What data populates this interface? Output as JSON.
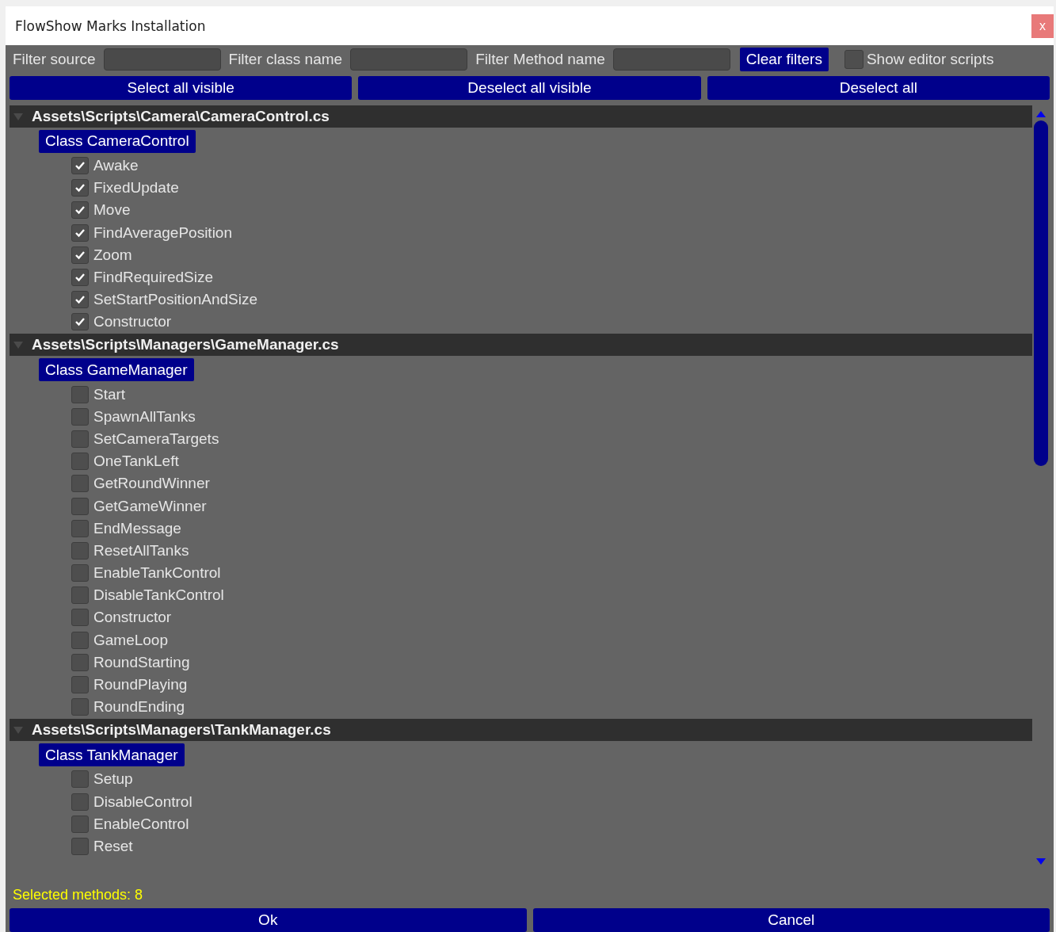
{
  "window": {
    "title": "FlowShow Marks Installation",
    "close": "x"
  },
  "filters": [
    {
      "label": "Filter source"
    },
    {
      "label": "Filter class name"
    },
    {
      "label": "Filter Method name"
    }
  ],
  "clear_filters": "Clear filters",
  "show_editor_scripts": {
    "label": "Show editor scripts",
    "checked": false
  },
  "actions": [
    "Select all visible",
    "Deselect all visible",
    "Deselect all"
  ],
  "sources": [
    {
      "path": "Assets\\Scripts\\Camera\\CameraControl.cs",
      "expanded": true,
      "classes": [
        {
          "name": "Class CameraControl",
          "methods": [
            {
              "name": "Awake",
              "checked": true
            },
            {
              "name": "FixedUpdate",
              "checked": true
            },
            {
              "name": "Move",
              "checked": true
            },
            {
              "name": "FindAveragePosition",
              "checked": true
            },
            {
              "name": "Zoom",
              "checked": true
            },
            {
              "name": "FindRequiredSize",
              "checked": true
            },
            {
              "name": "SetStartPositionAndSize",
              "checked": true
            },
            {
              "name": "Constructor",
              "checked": true
            }
          ]
        }
      ]
    },
    {
      "path": "Assets\\Scripts\\Managers\\GameManager.cs",
      "expanded": true,
      "classes": [
        {
          "name": "Class GameManager",
          "methods": [
            {
              "name": "Start",
              "checked": false
            },
            {
              "name": "SpawnAllTanks",
              "checked": false
            },
            {
              "name": "SetCameraTargets",
              "checked": false
            },
            {
              "name": "OneTankLeft",
              "checked": false
            },
            {
              "name": "GetRoundWinner",
              "checked": false
            },
            {
              "name": "GetGameWinner",
              "checked": false
            },
            {
              "name": "EndMessage",
              "checked": false
            },
            {
              "name": "ResetAllTanks",
              "checked": false
            },
            {
              "name": "EnableTankControl",
              "checked": false
            },
            {
              "name": "DisableTankControl",
              "checked": false
            },
            {
              "name": "Constructor",
              "checked": false
            },
            {
              "name": "GameLoop",
              "checked": false
            },
            {
              "name": "RoundStarting",
              "checked": false
            },
            {
              "name": "RoundPlaying",
              "checked": false
            },
            {
              "name": "RoundEnding",
              "checked": false
            }
          ]
        }
      ]
    },
    {
      "path": "Assets\\Scripts\\Managers\\TankManager.cs",
      "expanded": true,
      "classes": [
        {
          "name": "Class TankManager",
          "methods": [
            {
              "name": "Setup",
              "checked": false
            },
            {
              "name": "DisableControl",
              "checked": false
            },
            {
              "name": "EnableControl",
              "checked": false
            },
            {
              "name": "Reset",
              "checked": false
            }
          ]
        }
      ]
    }
  ],
  "status": "Selected methods: 8",
  "buttons": [
    "Ok",
    "Cancel"
  ]
}
